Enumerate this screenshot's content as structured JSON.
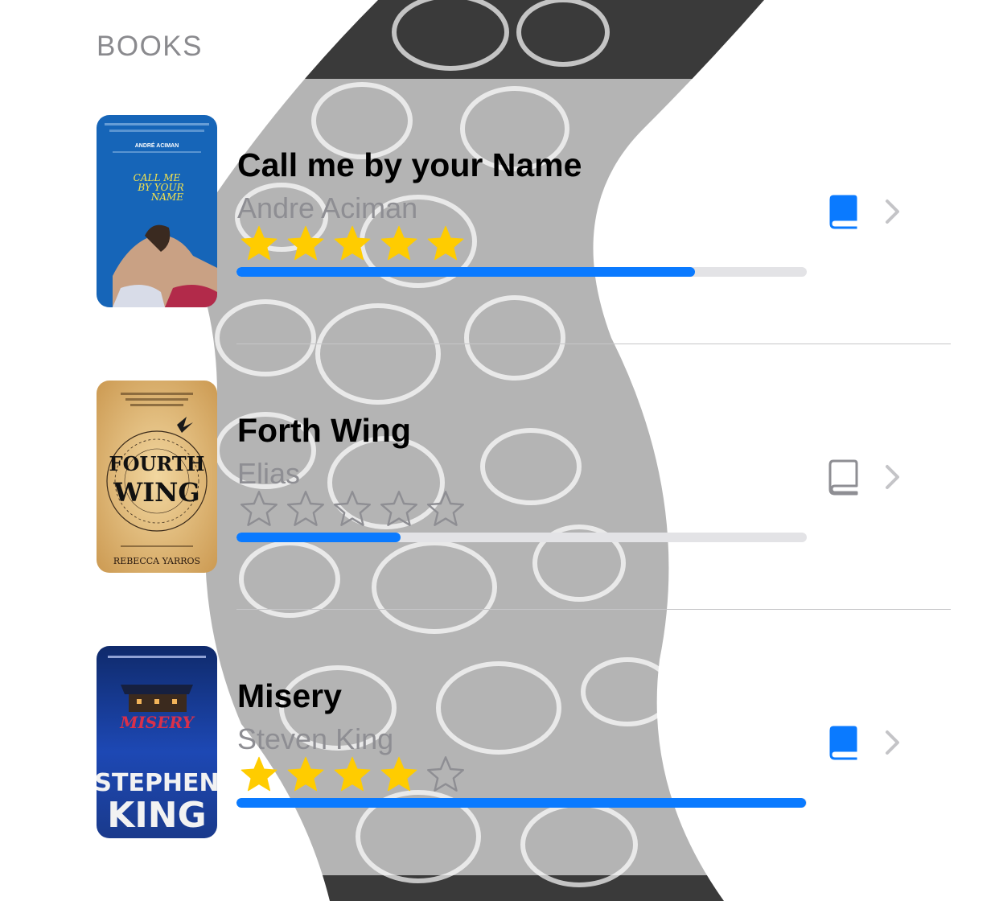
{
  "section": {
    "title": "BOOKS"
  },
  "colors": {
    "accent": "#0a7aff",
    "star_filled": "#ffcc00",
    "star_empty_stroke": "#8e8e93",
    "secondary_text": "#8e8e93",
    "icon_inactive": "#8e8e93"
  },
  "books": [
    {
      "title": "Call me by your Name",
      "author": "Andre Aciman",
      "rating": 5,
      "rating_max": 5,
      "progress": 0.804,
      "status_icon": "book-fill-icon",
      "status_active": true,
      "cover": {
        "top_text": "ANDRÉ ACIMAN",
        "title_text": [
          "CALL ME",
          "BY YOUR",
          "NAME"
        ]
      }
    },
    {
      "title": "Forth Wing",
      "author": "Elias",
      "rating": 0,
      "rating_max": 5,
      "progress": 0.288,
      "status_icon": "book-outline-icon",
      "status_active": false,
      "cover": {
        "top_text": "",
        "title_text": [
          "FOURTH",
          "WING"
        ],
        "bottom_text": "REBECCA YARROS"
      }
    },
    {
      "title": "Misery",
      "author": "Steven King",
      "rating": 4,
      "rating_max": 5,
      "progress": 0.998,
      "status_icon": "book-fill-icon",
      "status_active": true,
      "cover": {
        "top_text": "",
        "title_text": [
          "MISERY"
        ],
        "author_text": [
          "STEPHEN",
          "KING"
        ]
      }
    }
  ]
}
